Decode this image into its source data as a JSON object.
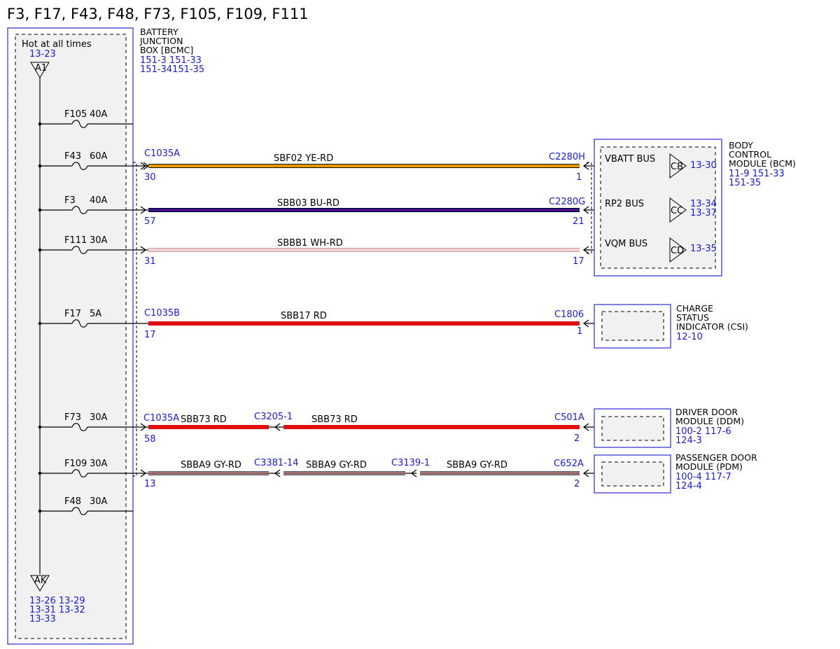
{
  "title": "F3, F17, F43, F48, F73, F105, F109, F111",
  "bjb": {
    "hot_label": "Hot at all times",
    "hot_ref": "13-23",
    "top_connector": "A1",
    "bottom_connector": "AK",
    "bottom_refs": [
      "13-26 13-29",
      "13-31 13-32",
      "13-33"
    ],
    "name_lines": [
      "BATTERY",
      "JUNCTION",
      "BOX [BCMC]"
    ],
    "refs": [
      "151-3  151-33",
      "151-34151-35"
    ]
  },
  "fuses": [
    {
      "id": "F105",
      "rating": "40A"
    },
    {
      "id": "F43",
      "rating": "60A"
    },
    {
      "id": "F3",
      "rating": "40A"
    },
    {
      "id": "F111",
      "rating": "30A"
    },
    {
      "id": "F17",
      "rating": "5A"
    },
    {
      "id": "F73",
      "rating": "30A"
    },
    {
      "id": "F109",
      "rating": "30A"
    },
    {
      "id": "F48",
      "rating": "30A"
    }
  ],
  "circuits": [
    {
      "start_connector": "C1035A",
      "start_pin": "30",
      "wire": "SBF02  YE-RD",
      "end_connector": "C2280H",
      "end_pin": "1",
      "color": "yellow"
    },
    {
      "start_connector": "",
      "start_pin": "57",
      "wire": "SBB03  BU-RD",
      "end_connector": "C2280G",
      "end_pin": "21",
      "color": "blue"
    },
    {
      "start_connector": "",
      "start_pin": "31",
      "wire": "SBBB1  WH-RD",
      "end_connector": "",
      "end_pin": "17",
      "color": "white"
    },
    {
      "start_connector": "C1035B",
      "start_pin": "17",
      "wire": "SBB17  RD",
      "end_connector": "C1806",
      "end_pin": "1",
      "color": "red"
    },
    {
      "start_connector": "C1035A",
      "start_pin": "58",
      "wire1": "SBB73  RD",
      "mid_connector": "C3205-1",
      "wire2": "SBB73  RD",
      "end_connector": "C501A",
      "end_pin": "2",
      "color": "red"
    },
    {
      "start_connector": "",
      "start_pin": "13",
      "wire1": "SBBA9  GY-RD",
      "mid1": "C3381-14",
      "wire2": "SBBA9  GY-RD",
      "mid2": "C3139-1",
      "wire3": "SBBA9  GY-RD",
      "end_connector": "C652A",
      "end_pin": "2",
      "color": "gray"
    }
  ],
  "bcm": {
    "name_lines": [
      "BODY",
      "CONTROL",
      "MODULE (BCM)"
    ],
    "refs": [
      "11-9   151-33",
      "151-35"
    ],
    "inputs": [
      {
        "label": "VBATT BUS",
        "pin": "CB",
        "refs": [
          "13-30"
        ]
      },
      {
        "label": "RP2 BUS",
        "pin": "CC",
        "refs": [
          "13-34",
          "13-37"
        ]
      },
      {
        "label": "VQM BUS",
        "pin": "CD",
        "refs": [
          "13-35"
        ]
      }
    ]
  },
  "csi": {
    "name_lines": [
      "CHARGE",
      "STATUS",
      "INDICATOR (CSI)"
    ],
    "refs": [
      "12-10"
    ]
  },
  "ddm": {
    "name_lines": [
      "DRIVER DOOR",
      "MODULE (DDM)"
    ],
    "refs": [
      "100-2 117-6",
      "124-3"
    ]
  },
  "pdm": {
    "name_lines": [
      "PASSENGER DOOR",
      "MODULE (PDM)"
    ],
    "refs": [
      "100-4 117-7",
      "124-4"
    ]
  },
  "colors": {
    "blue_text": "#1a1adc",
    "box_blue": "#2b2bd6",
    "yellow": "#f2c200",
    "blue": "#1010b0",
    "red": "#e01010",
    "gray": "#8c8c8c",
    "white": "#ffffff"
  }
}
